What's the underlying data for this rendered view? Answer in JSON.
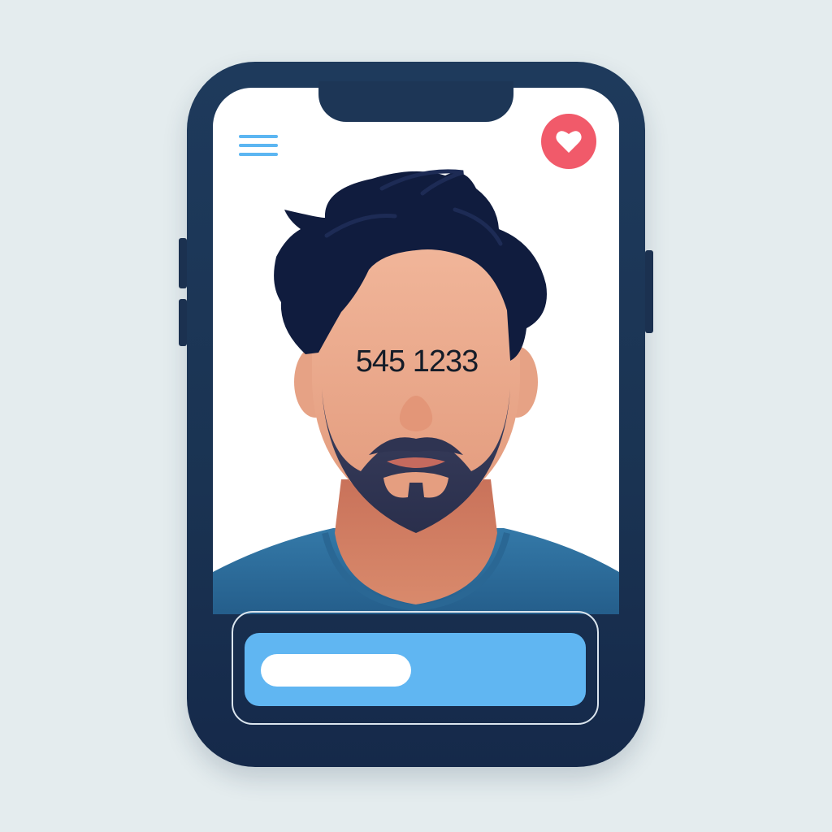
{
  "app": {
    "menu_icon": "hamburger-menu-icon",
    "like_icon": "heart-icon"
  },
  "profile": {
    "photo_number": "545 1233"
  },
  "progress": {
    "fraction": 0.44
  },
  "colors": {
    "phone_frame": "#1e3a5c",
    "accent_blue": "#60b6f2",
    "like_red": "#f15a6a",
    "shirt_blue": "#2e6f9e"
  }
}
